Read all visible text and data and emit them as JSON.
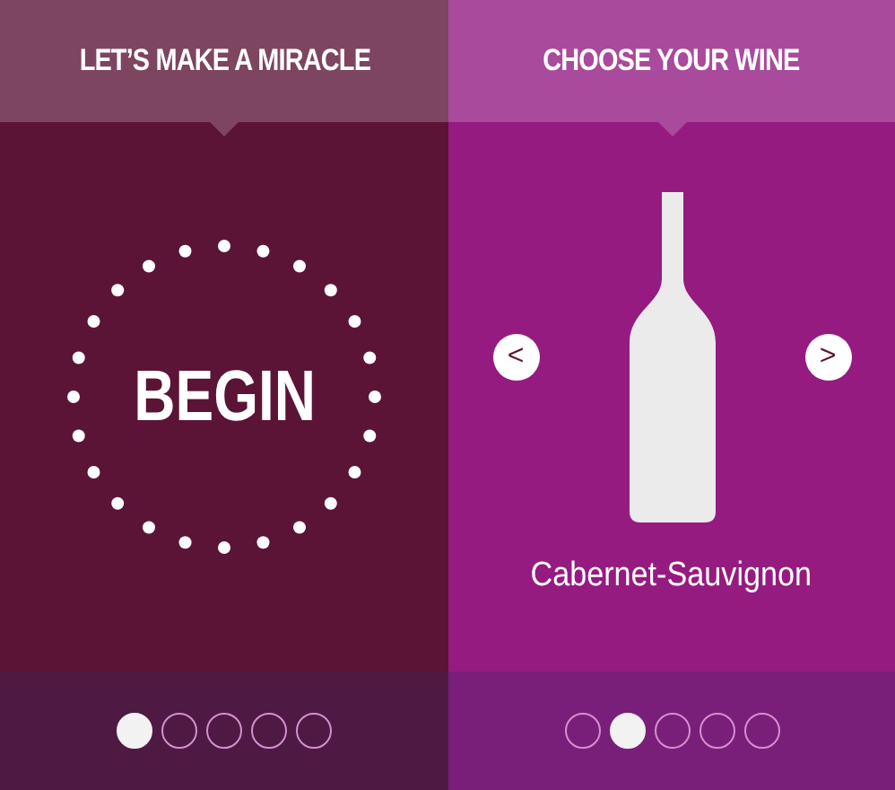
{
  "panels": [
    {
      "kind": "begin",
      "header": "LET’S MAKE A MIRACLE",
      "action": "BEGIN",
      "pager": [
        {
          "selected": true
        },
        {
          "selected": false
        },
        {
          "selected": false
        },
        {
          "selected": false
        },
        {
          "selected": false
        }
      ]
    },
    {
      "kind": "wine",
      "header": "CHOOSE YOUR WINE",
      "prev": "<",
      "next": ">",
      "wine": "Cabernet-Sauvignon",
      "pager": [
        {
          "selected": false
        },
        {
          "selected": true
        },
        {
          "selected": false
        },
        {
          "selected": false
        },
        {
          "selected": false
        }
      ]
    }
  ]
}
